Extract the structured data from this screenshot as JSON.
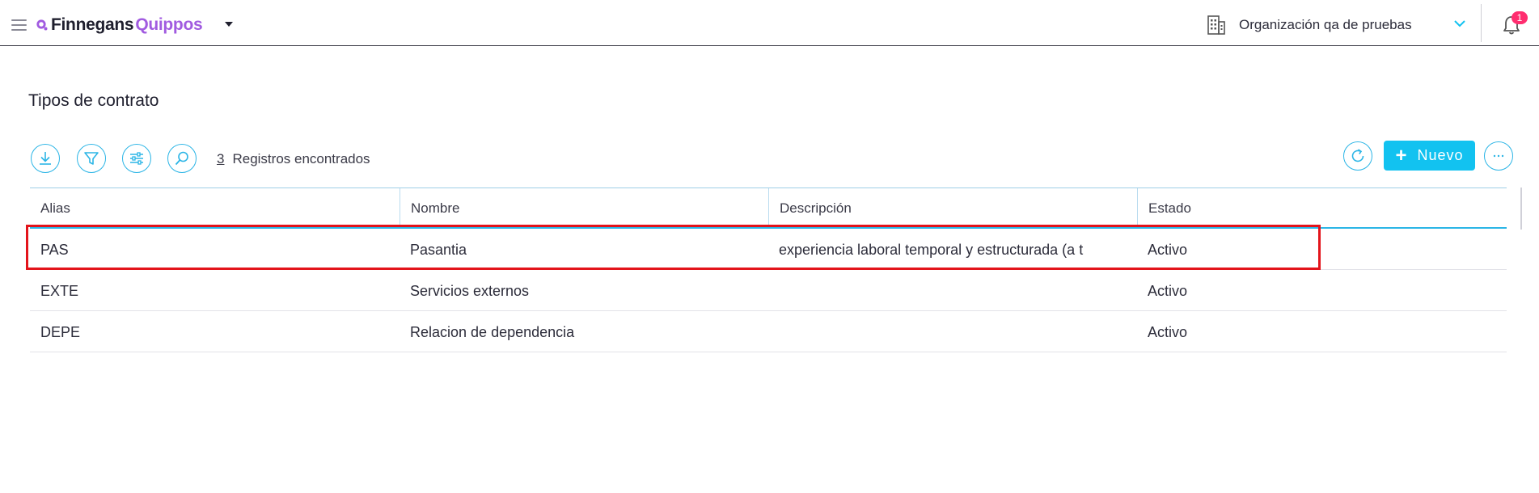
{
  "header": {
    "brand_primary": "Finnegans",
    "brand_secondary": "Quippos",
    "organization": "Organización qa de pruebas",
    "notifications_count": "1"
  },
  "page": {
    "title": "Tipos de contrato"
  },
  "toolbar": {
    "icons": [
      "download-icon",
      "filter-icon",
      "sliders-icon",
      "search-icon"
    ],
    "records_count": "3",
    "records_label": "Registros encontrados",
    "new_button_label": "Nuevo"
  },
  "table": {
    "columns": [
      "Alias",
      "Nombre",
      "Descripción",
      "Estado"
    ],
    "rows": [
      {
        "alias": "PAS",
        "nombre": "Pasantia",
        "descripcion": "experiencia laboral temporal y estructurada (a t",
        "estado": "Activo"
      },
      {
        "alias": "EXTE",
        "nombre": "Servicios externos",
        "descripcion": "",
        "estado": "Activo"
      },
      {
        "alias": "DEPE",
        "nombre": "Relacion de dependencia",
        "descripcion": "",
        "estado": "Activo"
      }
    ]
  },
  "colors": {
    "accent": "#12c2f0",
    "brand_purple": "#a15be0",
    "badge": "#ff2d6f",
    "highlight": "#e3141b"
  }
}
